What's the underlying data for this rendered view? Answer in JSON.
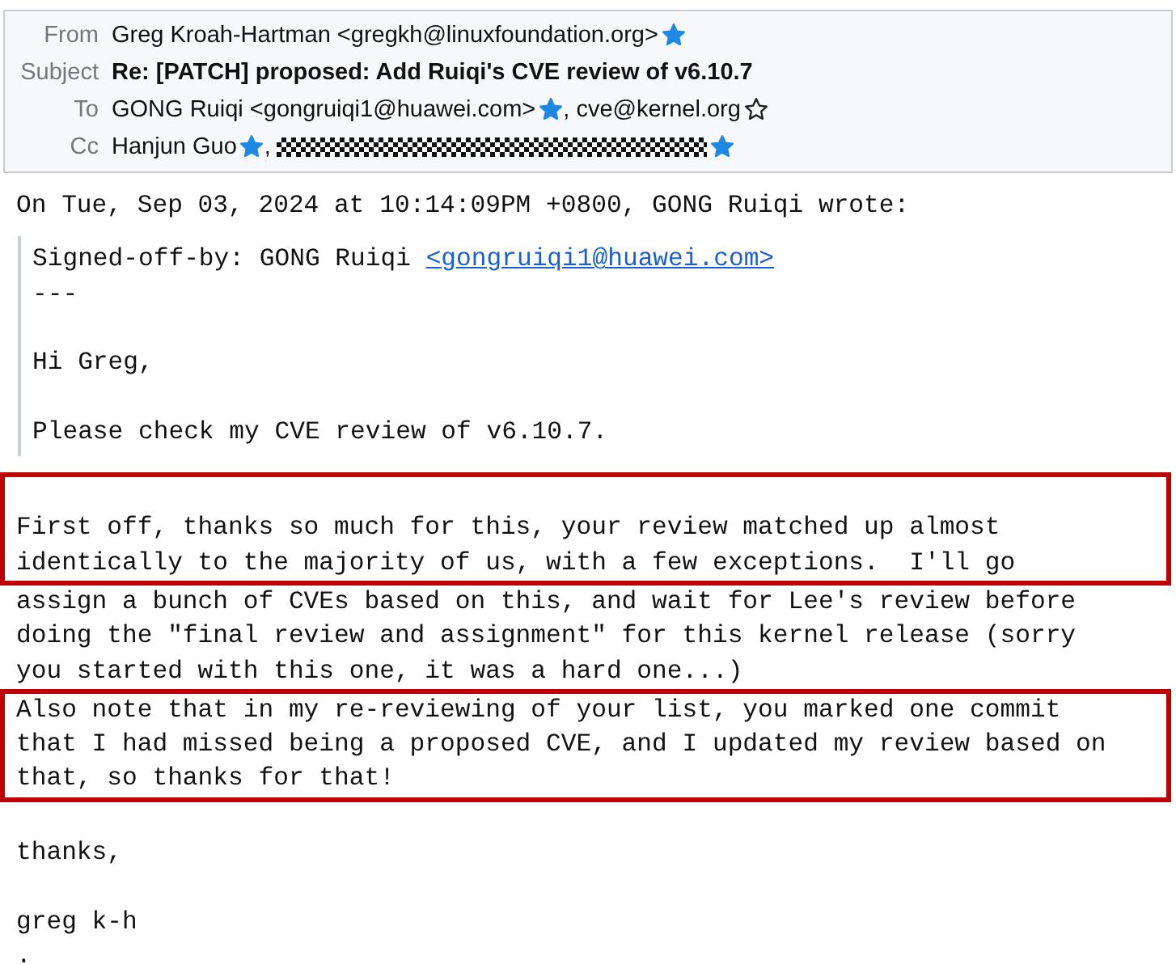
{
  "header": {
    "fields": [
      {
        "label": "From",
        "kind": "contacts",
        "contacts": [
          {
            "text": "Greg Kroah-Hartman <gregkh@linuxfoundation.org>",
            "starred": true
          }
        ]
      },
      {
        "label": "Subject",
        "kind": "subject",
        "text": "Re: [PATCH] proposed: Add Ruiqi's CVE review of v6.10.7"
      },
      {
        "label": "To",
        "kind": "contacts",
        "contacts": [
          {
            "text": "GONG Ruiqi <gongruiqi1@huawei.com>",
            "starred": true,
            "separator": ","
          },
          {
            "text": "cve@kernel.org",
            "starred": false
          }
        ]
      },
      {
        "label": "Cc",
        "kind": "contacts",
        "contacts": [
          {
            "text": "Hanjun Guo",
            "starred": true,
            "separator": ","
          },
          {
            "redacted": true,
            "starred": true
          }
        ]
      }
    ]
  },
  "attribution": "On Tue, Sep 03, 2024 at 10:14:09PM +0800, GONG Ruiqi wrote:",
  "quote": [
    [
      {
        "text": "Signed-off-by: GONG Ruiqi ",
        "link": "<gongruiqi1@huawei.com>"
      },
      {
        "text": "---"
      }
    ],
    [
      {
        "text": "Hi Greg,"
      }
    ],
    [
      {
        "text": "Please check my CVE review of v6.10.7."
      }
    ]
  ],
  "lines": [
    {
      "highlighted": true
    },
    {
      "text": "First off, thanks so much for this, your review matched up almost",
      "highlighted": true
    },
    {
      "text": "identically to the majority of us, with a few exceptions.  I'll go",
      "highlighted": true
    },
    {
      "text": "assign a bunch of CVEs based on this, and wait for Lee's review before",
      "highlighted": false
    },
    {
      "text": "doing the \"final review and assignment\" for this kernel release (sorry",
      "highlighted": false
    },
    {
      "text": "you started with this one, it was a hard one...)",
      "highlighted": false
    },
    {
      "text": "Also note that in my re-reviewing of your list, you marked one commit",
      "highlighted": true
    },
    {
      "text": "that I had missed being a proposed CVE, and I updated my review based on",
      "highlighted": true
    },
    {
      "text": "that, so thanks for that!",
      "highlighted": true
    },
    {
      "highlighted": false
    },
    {
      "text": "thanks,",
      "highlighted": false
    },
    {
      "highlighted": false
    },
    {
      "text": "greg k-h",
      "highlighted": false
    },
    {
      "text": ".",
      "highlighted": false
    }
  ]
}
